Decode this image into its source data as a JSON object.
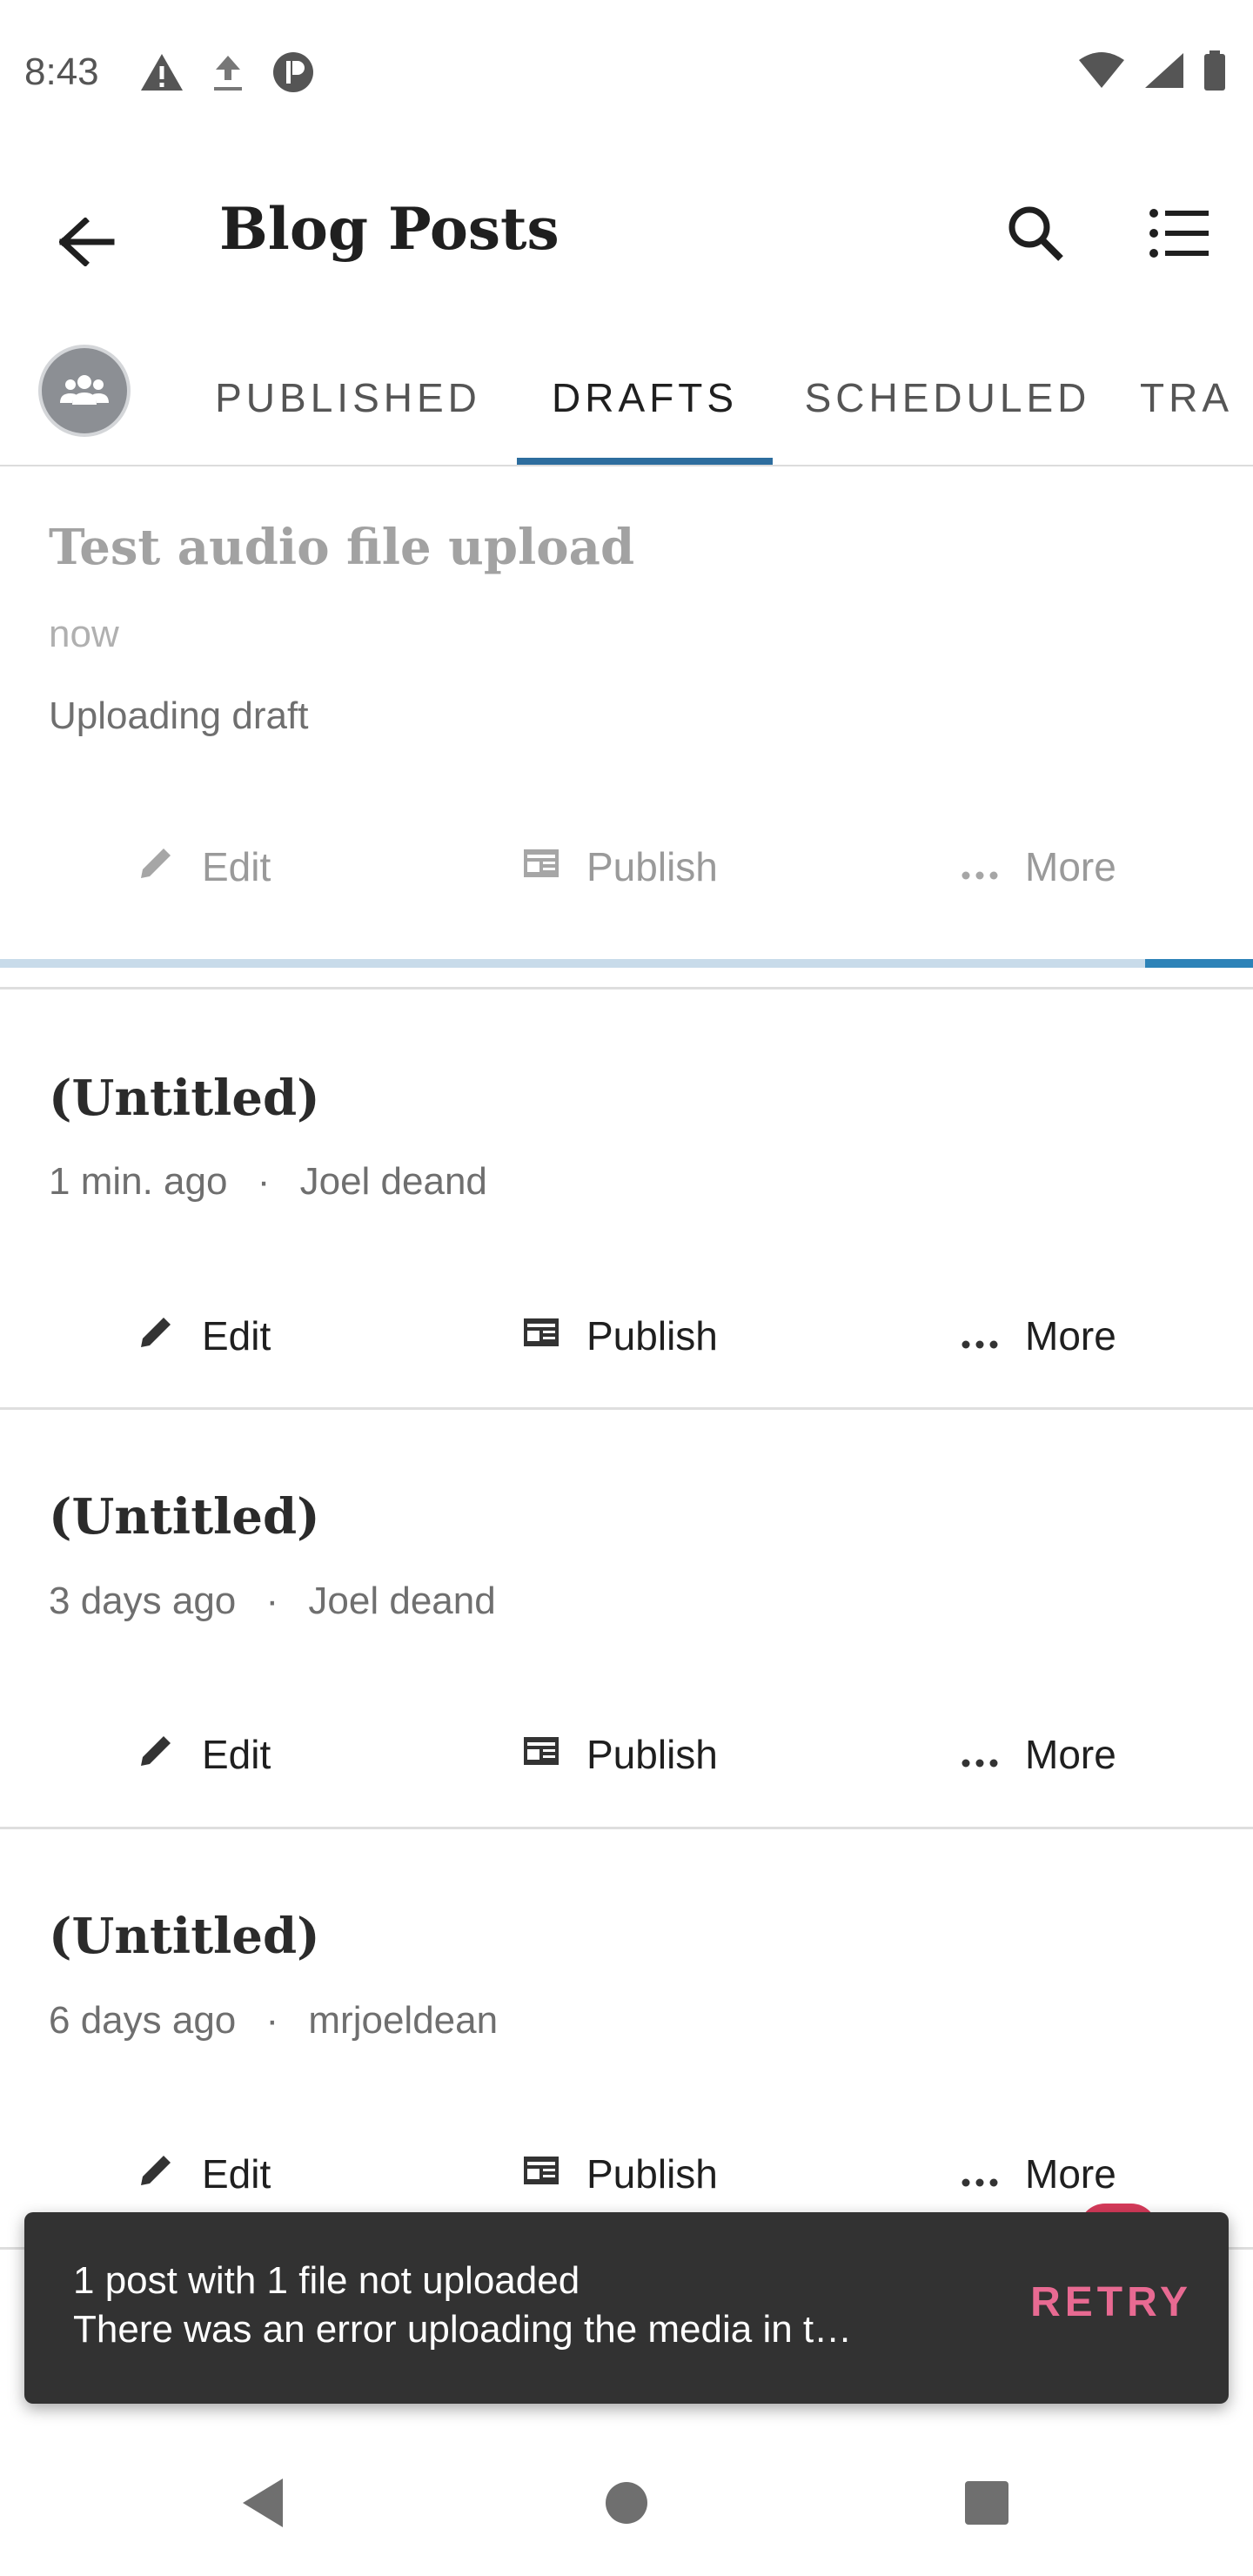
{
  "status_bar": {
    "time": "8:43",
    "left_icons": [
      "warning-icon",
      "upload-icon",
      "app-icon"
    ],
    "right_icons": [
      "wifi-icon",
      "signal-icon",
      "battery-icon"
    ]
  },
  "app_bar": {
    "title": "Blog Posts",
    "back_icon": "arrow-left-icon",
    "search_icon": "search-icon",
    "list_icon": "list-view-icon"
  },
  "tabs": [
    {
      "label": "PUBLISHED",
      "active": false
    },
    {
      "label": "DRAFTS",
      "active": true
    },
    {
      "label": "SCHEDULED",
      "active": false
    },
    {
      "label": "TRA",
      "active": false
    }
  ],
  "colors": {
    "accent": "#2d6d9e",
    "progress": "#2d83b8",
    "snackbar_bg": "#323232",
    "retry": "#e86a92"
  },
  "upload_progress": 0.09,
  "posts": [
    {
      "title": "Test audio file upload",
      "time": "now",
      "status": "Uploading draft",
      "actions": {
        "edit": "Edit",
        "publish": "Publish",
        "more": "More"
      }
    },
    {
      "title": "(Untitled)",
      "time": "1 min. ago",
      "separator": "·",
      "author": "Joel deand",
      "actions": {
        "edit": "Edit",
        "publish": "Publish",
        "more": "More"
      }
    },
    {
      "title": "(Untitled)",
      "time": "3 days ago",
      "separator": "·",
      "author": "Joel deand",
      "actions": {
        "edit": "Edit",
        "publish": "Publish",
        "more": "More"
      }
    },
    {
      "title": "(Untitled)",
      "time": "6 days ago",
      "separator": "·",
      "author": "mrjoeldean",
      "actions": {
        "edit": "Edit",
        "publish": "Publish",
        "more": "More"
      }
    }
  ],
  "snackbar": {
    "line1": "1 post with 1 file not uploaded",
    "line2": "There was an error uploading the media in t…",
    "action": "RETRY"
  },
  "nav_bar": {
    "back": "nav-back-icon",
    "home": "nav-home-icon",
    "recents": "nav-recents-icon"
  }
}
